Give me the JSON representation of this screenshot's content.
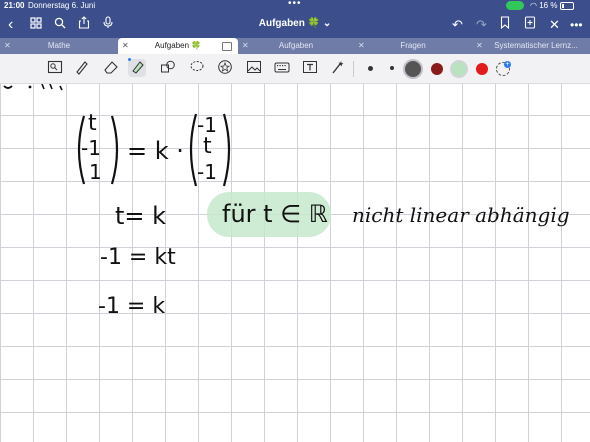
{
  "status": {
    "time": "21:00",
    "date": "Donnerstag 6. Juni",
    "battery": "16 %"
  },
  "toolbar": {
    "title": "Aufgaben",
    "title_icon": "🍀",
    "chevron": "⌄"
  },
  "tabs": [
    {
      "label": "Mathe",
      "active": false
    },
    {
      "label": "Aufgaben 🍀",
      "active": true
    },
    {
      "label": "Aufgaben",
      "active": false
    },
    {
      "label": "Fragen",
      "active": false
    },
    {
      "label": "Systematischer Lernz...",
      "active": false
    }
  ],
  "colors": {
    "toolbar": "#3c4f8c",
    "tabbar": "#6f7ca8",
    "highlight": "#c6e8cb",
    "red1": "#8b1a1a",
    "red2": "#e21b1b",
    "green": "#b9e2bf",
    "grid": "#cfd2d8"
  },
  "icons": {
    "back": "chevron-left-icon",
    "grid": "grid-icon",
    "search": "search-icon",
    "share": "share-icon",
    "mic": "microphone-icon",
    "undo": "undo-icon",
    "redo": "redo-icon",
    "bookmark": "bookmark-icon",
    "add_page": "add-page-icon",
    "close": "close-icon",
    "more": "more-icon"
  },
  "note": {
    "matrix_left": [
      "t",
      "-1",
      "1"
    ],
    "equals_k": "= k ·",
    "matrix_right": [
      "-1",
      "t",
      "-1"
    ],
    "line1": "t= k",
    "line1_note": "für t ∈ ℝ",
    "line1_text": "nicht linear abhängig",
    "line2": "-1 = kt",
    "line3": "-1 = k"
  }
}
